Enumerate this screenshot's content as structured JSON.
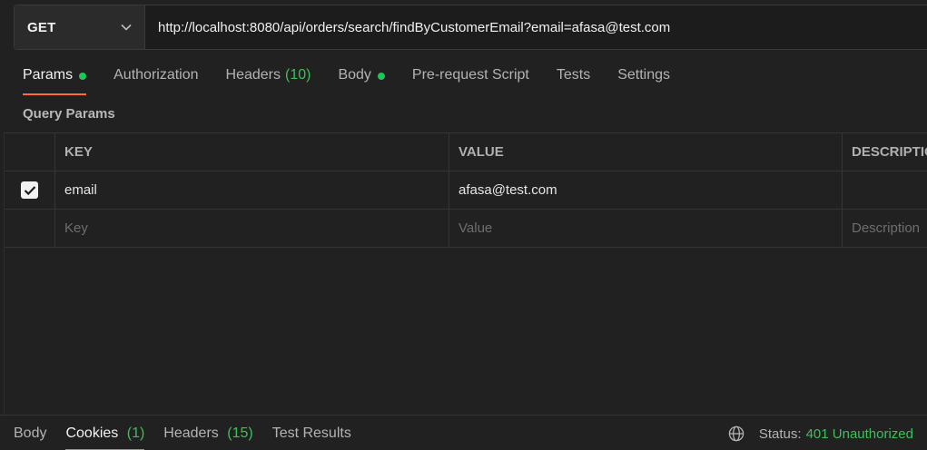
{
  "request": {
    "method": "GET",
    "url": "http://localhost:8080/api/orders/search/findByCustomerEmail?email=afasa@test.com"
  },
  "tabs": [
    {
      "label": "Params",
      "dot": true,
      "active": true
    },
    {
      "label": "Authorization"
    },
    {
      "label": "Headers",
      "count": "(10)"
    },
    {
      "label": "Body",
      "dot": true
    },
    {
      "label": "Pre-request Script"
    },
    {
      "label": "Tests"
    },
    {
      "label": "Settings"
    }
  ],
  "query_params": {
    "title": "Query Params",
    "columns": {
      "key": "KEY",
      "value": "VALUE",
      "description": "DESCRIPTIO"
    },
    "rows": [
      {
        "checked": true,
        "key": "email",
        "value": "afasa@test.com",
        "description": ""
      }
    ],
    "placeholders": {
      "key": "Key",
      "value": "Value",
      "description": "Description"
    }
  },
  "response": {
    "tabs": [
      {
        "label": "Body"
      },
      {
        "label": "Cookies",
        "count": "(1)",
        "active": true
      },
      {
        "label": "Headers",
        "count": "(15)"
      },
      {
        "label": "Test Results"
      }
    ],
    "status_label": "Status:",
    "status_value": "401 Unauthorized"
  },
  "colors": {
    "accent": "#ff6c37",
    "success": "#3fbe5b",
    "background": "#212121"
  },
  "icons": {
    "method_dropdown": "chevron-down-icon",
    "checkbox": "check-icon",
    "network": "globe-icon"
  }
}
